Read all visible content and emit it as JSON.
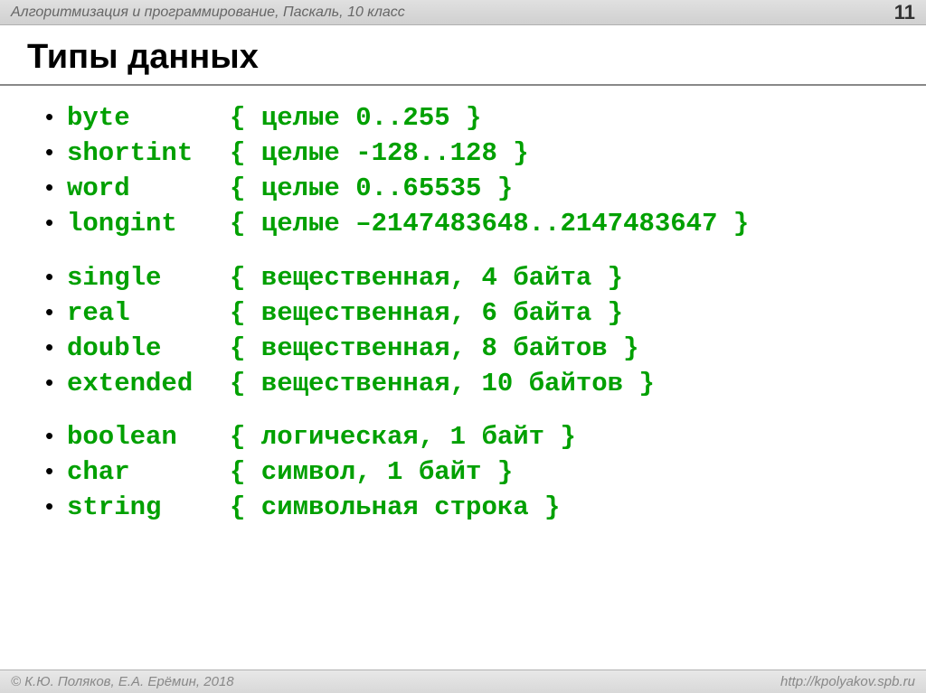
{
  "header": {
    "title": "Алгоритмизация и программирование, Паскаль, 10 класс",
    "page": "11"
  },
  "title": "Типы данных",
  "groups": [
    {
      "items": [
        {
          "name": "byte",
          "desc": "{ целые 0..255 }"
        },
        {
          "name": "shortint",
          "desc": "{ целые -128..128 }"
        },
        {
          "name": "word",
          "desc": "{ целые 0..65535 }"
        },
        {
          "name": "longint",
          "desc": "{ целые –2147483648..2147483647 }"
        }
      ]
    },
    {
      "items": [
        {
          "name": "single",
          "desc": "{ вещественная, 4 байта }"
        },
        {
          "name": "real",
          "desc": "{ вещественная, 6 байта }"
        },
        {
          "name": "double",
          "desc": "{ вещественная, 8 байтов }"
        },
        {
          "name": "extended",
          "desc": "{ вещественная, 10 байтов }"
        }
      ]
    },
    {
      "items": [
        {
          "name": "boolean",
          "desc": "{ логическая, 1 байт }"
        },
        {
          "name": "char",
          "desc": "{ символ, 1 байт }"
        },
        {
          "name": "string",
          "desc": "{ символьная строка }"
        }
      ]
    }
  ],
  "footer": {
    "left": "© К.Ю. Поляков, Е.А. Ерёмин, 2018",
    "right": "http://kpolyakov.spb.ru"
  }
}
